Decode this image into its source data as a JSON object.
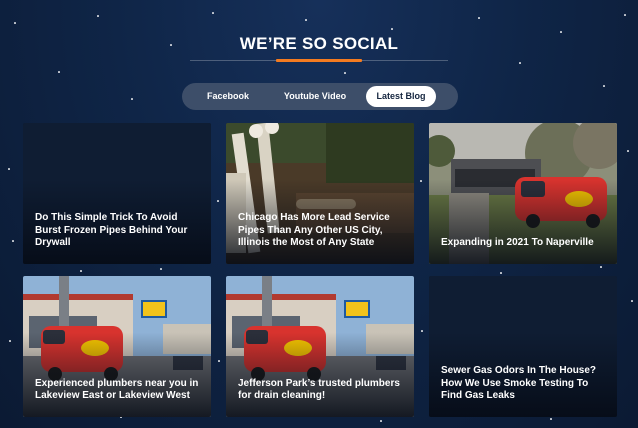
{
  "section": {
    "title": "WE’RE SO SOCIAL"
  },
  "tabs": [
    {
      "label": "Facebook",
      "active": false
    },
    {
      "label": "Youtube Video",
      "active": false
    },
    {
      "label": "Latest Blog",
      "active": true
    }
  ],
  "colors": {
    "accent": "#f47b20",
    "background": "#0f2547",
    "tab_bar": "#3d4e69",
    "active_tab_text": "#14253f"
  },
  "posts": [
    {
      "title": "Do This Simple Trick To Avoid Burst Frozen Pipes Behind Your Drywall",
      "image": "none"
    },
    {
      "title": "Chicago Has More Lead Service Pipes Than Any Other US City, Illinois the Most of Any State",
      "image": "pipes-in-dirt"
    },
    {
      "title": "Expanding in 2021 To Naperville",
      "image": "van-by-building"
    },
    {
      "title": "Experienced plumbers near you in Lakeview East or Lakeview West",
      "image": "van-on-street"
    },
    {
      "title": "Jefferson Park’s trusted plumbers for drain cleaning!",
      "image": "van-on-street"
    },
    {
      "title": "Sewer Gas Odors In The House? How We Use Smoke Testing To Find Gas Leaks",
      "image": "none"
    }
  ]
}
